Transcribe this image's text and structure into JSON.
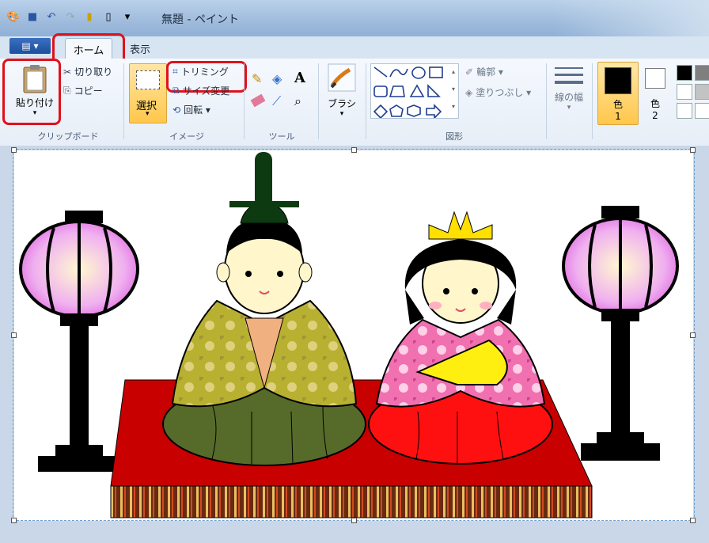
{
  "window": {
    "title": "無題 - ペイント"
  },
  "tabs": {
    "file_label": "▤ ▾",
    "home": "ホーム",
    "view": "表示"
  },
  "clipboard": {
    "paste": "貼り付け",
    "cut": "切り取り",
    "copy": "コピー",
    "group": "クリップボード"
  },
  "image": {
    "select": "選択",
    "crop": "トリミング",
    "resize": "サイズ変更",
    "rotate": "回転 ▾",
    "group": "イメージ"
  },
  "tools": {
    "group": "ツール",
    "text_tool": "A"
  },
  "brush": {
    "label": "ブラシ"
  },
  "shapes": {
    "group": "図形",
    "outline": "輪郭 ▾",
    "fill": "塗りつぶし ▾"
  },
  "size": {
    "label": "線の幅"
  },
  "colors": {
    "color1": "色\n1",
    "color1_a": "色",
    "color1_b": "1",
    "color2_a": "色",
    "color2_b": "2",
    "color1_hex": "#000000",
    "color2_hex": "#ffffff"
  },
  "accents": {
    "highlight": "#e0111b",
    "ribbon_bg": "#e7eef7"
  }
}
